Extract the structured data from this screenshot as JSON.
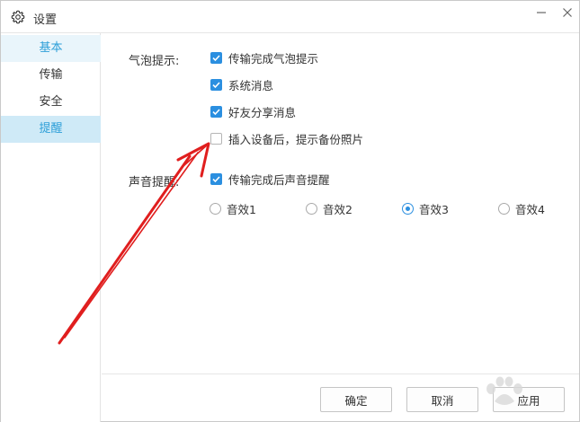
{
  "window": {
    "title": "设置",
    "icon": "gear-icon",
    "minimize_icon": "minimize-icon",
    "close_icon": "close-icon"
  },
  "sidebar": {
    "items": [
      {
        "label": "基本",
        "state": "light"
      },
      {
        "label": "传输",
        "state": "normal"
      },
      {
        "label": "安全",
        "state": "normal"
      },
      {
        "label": "提醒",
        "state": "selected"
      }
    ]
  },
  "bubble": {
    "label": "气泡提示:",
    "options": [
      {
        "label": "传输完成气泡提示",
        "checked": true
      },
      {
        "label": "系统消息",
        "checked": true
      },
      {
        "label": "好友分享消息",
        "checked": true
      },
      {
        "label": "插入设备后，提示备份照片",
        "checked": false
      }
    ]
  },
  "sound": {
    "label": "声音提醒:",
    "option": {
      "label": "传输完成后声音提醒",
      "checked": true
    },
    "effects": [
      {
        "label": "音效1",
        "selected": false
      },
      {
        "label": "音效2",
        "selected": false
      },
      {
        "label": "音效3",
        "selected": true
      },
      {
        "label": "音效4",
        "selected": false
      }
    ]
  },
  "footer": {
    "ok_label": "确定",
    "cancel_label": "取消",
    "apply_label": "应用"
  },
  "colors": {
    "accent": "#2b8fe0",
    "sidebar_selected": "#cfeaf7",
    "annotation_arrow": "#e01e1e"
  }
}
